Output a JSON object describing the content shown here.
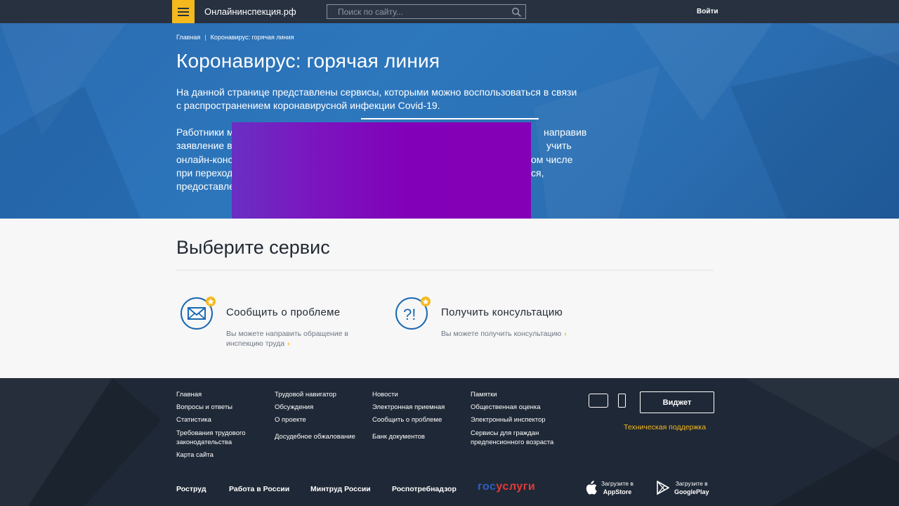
{
  "header": {
    "site_name": "Онлайнинспекция.рф",
    "search_placeholder": "Поиск по сайту...",
    "login_label": "Войти"
  },
  "breadcrumb": {
    "home": "Главная",
    "separator": "|",
    "current": "Коронавирус: горячая линия"
  },
  "hero": {
    "title": "Коронавирус: горячая линия",
    "lead": "На данной странице представлены сервисы, которыми можно воспользоваться в связи с распространением коронавирусной инфекции Covid-19.",
    "text_lines": [
      {
        "left": "Работники м",
        "right": "направив"
      },
      {
        "left": "заявление в",
        "right": "учить"
      },
      {
        "left": "онлайн-конс",
        "right": "ом числе"
      },
      {
        "left": "при переход",
        "right": "ся,"
      },
      {
        "left": "предоставле",
        "right": ""
      }
    ]
  },
  "services": {
    "title": "Выберите сервис",
    "items": [
      {
        "title": "Сообщить о проблеме",
        "desc_line1": "Вы можете направить обращение в",
        "desc_line2": "инспекцию труда",
        "icon": "envelope-icon"
      },
      {
        "title": "Получить консультацию",
        "desc_line1": "Вы можете получить консультацию",
        "desc_line2": "",
        "icon": "question-exclamation-icon"
      }
    ]
  },
  "footer": {
    "columns": [
      [
        "Главная",
        "Вопросы и ответы",
        "Статистика",
        "Требования трудового законодательства",
        "Карта сайта"
      ],
      [
        "Трудовой навигатор",
        "Обсуждения",
        "О проекте",
        "Досудебное обжалование"
      ],
      [
        "Новости",
        "Электронная приемная",
        "Сообщить о проблеме",
        "Банк документов"
      ],
      [
        "Памятки",
        "Общественная оценка",
        "Электронный инспектор",
        "Сервисы для граждан предпенсионного возраста"
      ]
    ],
    "widget_label": "Виджет",
    "support_label": "Техническая поддержка",
    "partners": [
      "Роструд",
      "Работа в России",
      "Минтруд России",
      "Роспотребнадзор"
    ],
    "gosuslugi": {
      "part1": "гос",
      "part2": "услуги"
    },
    "app_store": {
      "line1": "Загрузите в",
      "line2": "AppStore"
    },
    "google_play": {
      "line1": "Загрузите в",
      "line2": "GooglePlay"
    },
    "colors": {
      "accent": "#f5b91e",
      "footer_bg": "#1f2836",
      "hero_blue": "#2d77bd"
    }
  }
}
